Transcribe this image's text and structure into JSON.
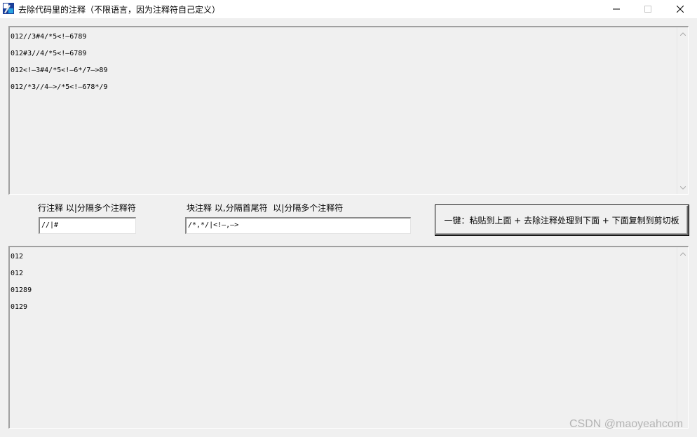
{
  "window": {
    "title": "去除代码里的注释（不限语言，因为注释符自己定义）",
    "controls": {
      "minimize_icon": "minimize-icon",
      "maximize_icon": "maximize-icon",
      "close_icon": "close-icon"
    }
  },
  "input_area": {
    "lines": [
      "012//3#4/*5<!—6789",
      "012#3//4/*5<!—6789",
      "012<!—3#4/*5<!—6*/7—>89",
      "012/*3//4—>/*5<!—678*/9"
    ]
  },
  "controls": {
    "line_comment_label": "行注释 以|分隔多个注释符",
    "line_comment_value": "//|#",
    "block_comment_label": "块注释 以,分隔首尾符  以|分隔多个注释符",
    "block_comment_value": "/*,*/|<!—,—>",
    "action_button_label": "一键：粘贴到上面 + 去除注释处理到下面 + 下面复制到剪切板"
  },
  "output_area": {
    "lines": [
      "012",
      "012",
      "01289",
      "0129"
    ]
  },
  "watermark": "CSDN @maoyeahcom"
}
